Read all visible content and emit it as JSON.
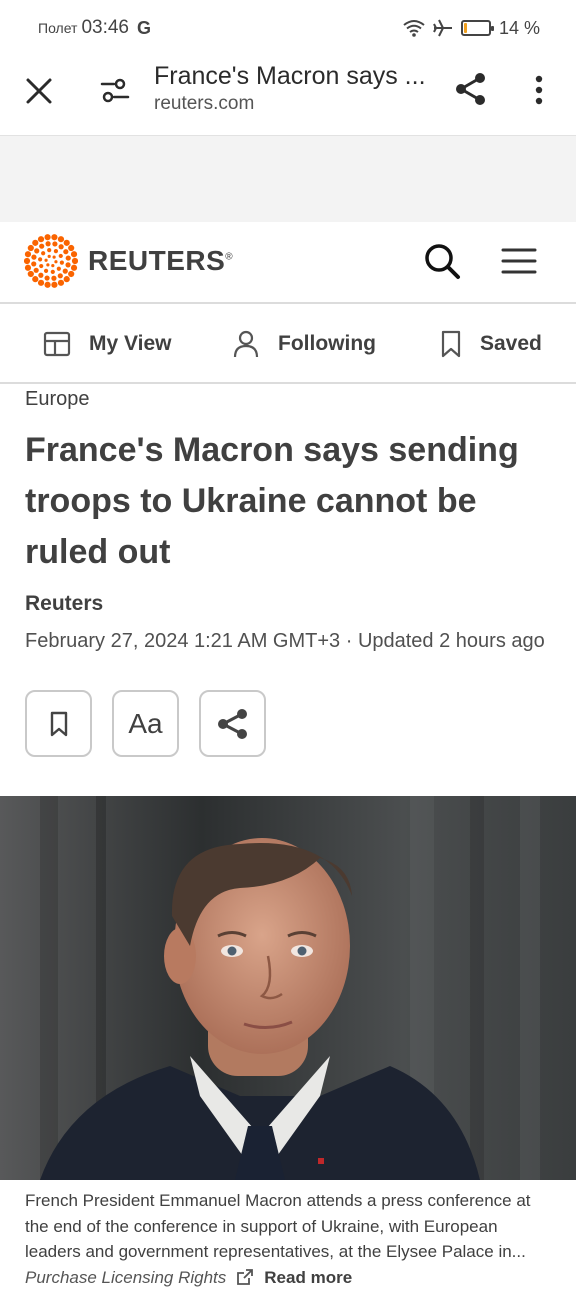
{
  "status": {
    "carrier": "Полет",
    "time": "03:46",
    "g_label": "G",
    "battery": "14 %",
    "battery_level": 0.14
  },
  "browser": {
    "tab_title": "France's Macron says ...",
    "url": "reuters.com"
  },
  "site": {
    "brand": "REUTERS",
    "brand_mark": "®"
  },
  "subnav": {
    "items": [
      {
        "label": "My View"
      },
      {
        "label": "Following"
      },
      {
        "label": "Saved"
      }
    ]
  },
  "article": {
    "section": "Europe",
    "headline": "France's Macron says sending troops to Ukraine cannot be ruled out",
    "byline": "Reuters",
    "dateline": "February 27, 2024 1:21 AM GMT+3 · Updated 2 hours ago",
    "actions": {
      "font_label": "Aa"
    }
  },
  "caption": {
    "text": "French President Emmanuel Macron attends a press conference at the end of the conference in support of Ukraine, with European leaders and government representatives, at the Elysee Palace in...",
    "purchase": "Purchase Licensing Rights",
    "read_more": "Read more"
  },
  "colors": {
    "brand_orange": "#fa6400",
    "text": "#404040",
    "battery": "#f0a01f"
  }
}
